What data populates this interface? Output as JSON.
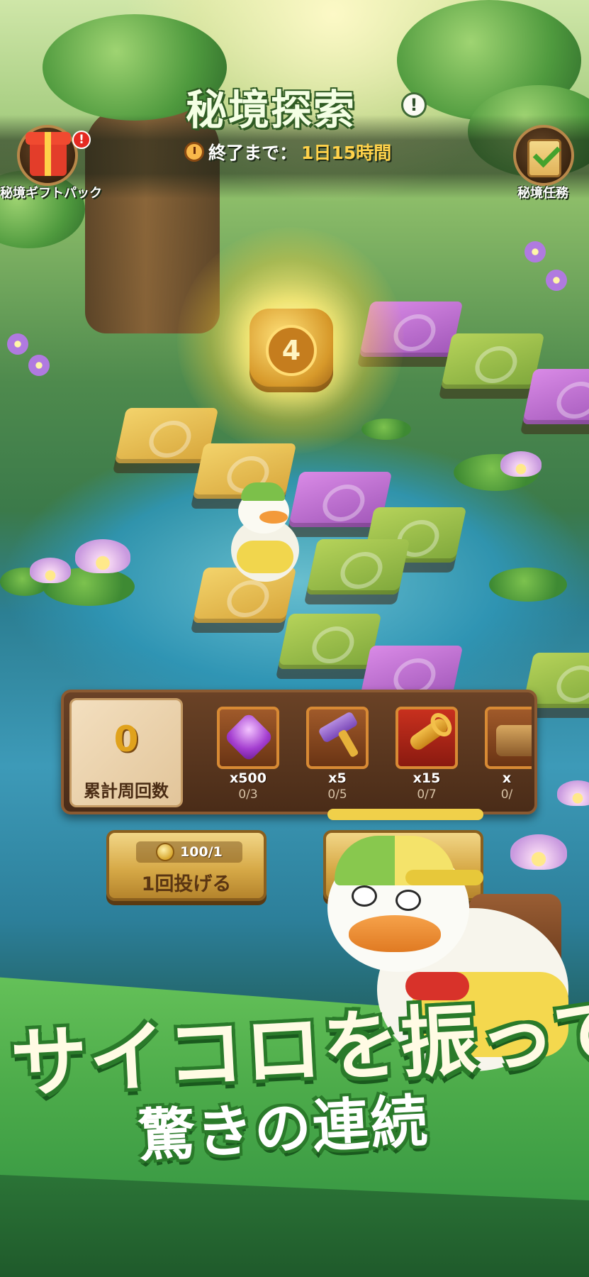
{
  "event": {
    "title": "秘境探索",
    "info_glyph": "!",
    "timer_label": "終了まで：",
    "timer_value": "1日15時間"
  },
  "side_buttons": {
    "gift_pack": {
      "label": "秘境ギフトパック",
      "badge": "!",
      "icon": "gift-box-icon"
    },
    "missions": {
      "label": "秘境任務",
      "icon": "scroll-check-icon"
    }
  },
  "dice": {
    "value": "4"
  },
  "laps": {
    "count": "0",
    "label": "累計周回数"
  },
  "rewards": [
    {
      "amount": "x500",
      "progress": "0/3",
      "icon": "purple-gem-icon"
    },
    {
      "amount": "x5",
      "progress": "0/5",
      "icon": "hammer-icon"
    },
    {
      "amount": "x15",
      "progress": "0/7",
      "icon": "golden-key-icon"
    },
    {
      "amount": "x",
      "progress": "0/",
      "icon": "treasure-chest-icon"
    }
  ],
  "throw_button": {
    "cost": "100/1",
    "label": "1回投げる"
  },
  "promo": {
    "line1": "サイコロを振って",
    "line2": "驚きの連続"
  },
  "colors": {
    "title_text": "#f4ffe4",
    "timer_value": "#ffd24a",
    "banner_green": "#4cab4a",
    "panel_brown": "#6a4226",
    "alert_red": "#e42a22"
  }
}
